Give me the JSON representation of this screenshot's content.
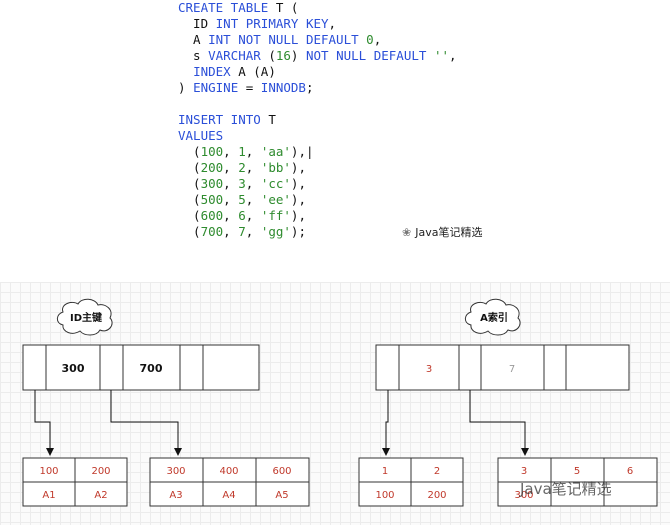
{
  "code": {
    "lines": [
      [
        {
          "t": "k",
          "v": "CREATE TABLE"
        },
        {
          "t": "t",
          "v": " T ("
        }
      ],
      [
        {
          "t": "t",
          "v": "  ID "
        },
        {
          "t": "k",
          "v": "INT PRIMARY KEY"
        },
        {
          "t": "t",
          "v": ","
        }
      ],
      [
        {
          "t": "t",
          "v": "  A "
        },
        {
          "t": "k",
          "v": "INT NOT NULL DEFAULT"
        },
        {
          "t": "t",
          "v": " "
        },
        {
          "t": "n",
          "v": "0"
        },
        {
          "t": "t",
          "v": ","
        }
      ],
      [
        {
          "t": "t",
          "v": "  s "
        },
        {
          "t": "k",
          "v": "VARCHAR"
        },
        {
          "t": "t",
          "v": " ("
        },
        {
          "t": "n",
          "v": "16"
        },
        {
          "t": "t",
          "v": ") "
        },
        {
          "t": "k",
          "v": "NOT NULL DEFAULT"
        },
        {
          "t": "t",
          "v": " "
        },
        {
          "t": "s",
          "v": "''"
        },
        {
          "t": "t",
          "v": ","
        }
      ],
      [
        {
          "t": "t",
          "v": "  "
        },
        {
          "t": "k",
          "v": "INDEX"
        },
        {
          "t": "t",
          "v": " A (A)"
        }
      ],
      [
        {
          "t": "t",
          "v": ") "
        },
        {
          "t": "k",
          "v": "ENGINE"
        },
        {
          "t": "t",
          "v": " = "
        },
        {
          "t": "k",
          "v": "INNODB"
        },
        {
          "t": "t",
          "v": ";"
        }
      ],
      [],
      [
        {
          "t": "k",
          "v": "INSERT INTO"
        },
        {
          "t": "t",
          "v": " T"
        }
      ],
      [
        {
          "t": "k",
          "v": "VALUES"
        }
      ],
      [
        {
          "t": "t",
          "v": "  ("
        },
        {
          "t": "n",
          "v": "100"
        },
        {
          "t": "t",
          "v": ", "
        },
        {
          "t": "n",
          "v": "1"
        },
        {
          "t": "t",
          "v": ", "
        },
        {
          "t": "s",
          "v": "'aa'"
        },
        {
          "t": "t",
          "v": "),|"
        }
      ],
      [
        {
          "t": "t",
          "v": "  ("
        },
        {
          "t": "n",
          "v": "200"
        },
        {
          "t": "t",
          "v": ", "
        },
        {
          "t": "n",
          "v": "2"
        },
        {
          "t": "t",
          "v": ", "
        },
        {
          "t": "s",
          "v": "'bb'"
        },
        {
          "t": "t",
          "v": "),"
        }
      ],
      [
        {
          "t": "t",
          "v": "  ("
        },
        {
          "t": "n",
          "v": "300"
        },
        {
          "t": "t",
          "v": ", "
        },
        {
          "t": "n",
          "v": "3"
        },
        {
          "t": "t",
          "v": ", "
        },
        {
          "t": "s",
          "v": "'cc'"
        },
        {
          "t": "t",
          "v": "),"
        }
      ],
      [
        {
          "t": "t",
          "v": "  ("
        },
        {
          "t": "n",
          "v": "500"
        },
        {
          "t": "t",
          "v": ", "
        },
        {
          "t": "n",
          "v": "5"
        },
        {
          "t": "t",
          "v": ", "
        },
        {
          "t": "s",
          "v": "'ee'"
        },
        {
          "t": "t",
          "v": "),"
        }
      ],
      [
        {
          "t": "t",
          "v": "  ("
        },
        {
          "t": "n",
          "v": "600"
        },
        {
          "t": "t",
          "v": ", "
        },
        {
          "t": "n",
          "v": "6"
        },
        {
          "t": "t",
          "v": ", "
        },
        {
          "t": "s",
          "v": "'ff'"
        },
        {
          "t": "t",
          "v": "),"
        }
      ],
      [
        {
          "t": "t",
          "v": "  ("
        },
        {
          "t": "n",
          "v": "700"
        },
        {
          "t": "t",
          "v": ", "
        },
        {
          "t": "n",
          "v": "7"
        },
        {
          "t": "t",
          "v": ", "
        },
        {
          "t": "s",
          "v": "'gg'"
        },
        {
          "t": "t",
          "v": ");"
        }
      ]
    ]
  },
  "watermark_top": "Java笔记精选",
  "watermark_bottom": "Java笔记精选",
  "diagram": {
    "id_index": {
      "label": "ID主键",
      "root": [
        "300",
        "700"
      ],
      "leaves": [
        {
          "keys": [
            "100",
            "200"
          ],
          "values": [
            "A1",
            "A2"
          ]
        },
        {
          "keys": [
            "300",
            "400",
            "600"
          ],
          "values": [
            "A3",
            "A4",
            "A5"
          ]
        }
      ]
    },
    "a_index": {
      "label": "A索引",
      "root": [
        "3",
        "7"
      ],
      "leaves": [
        {
          "keys": [
            "1",
            "2"
          ],
          "values": [
            "100",
            "200"
          ]
        },
        {
          "keys": [
            "3",
            "5",
            "6"
          ],
          "values": [
            "300",
            "",
            ""
          ]
        }
      ]
    }
  }
}
